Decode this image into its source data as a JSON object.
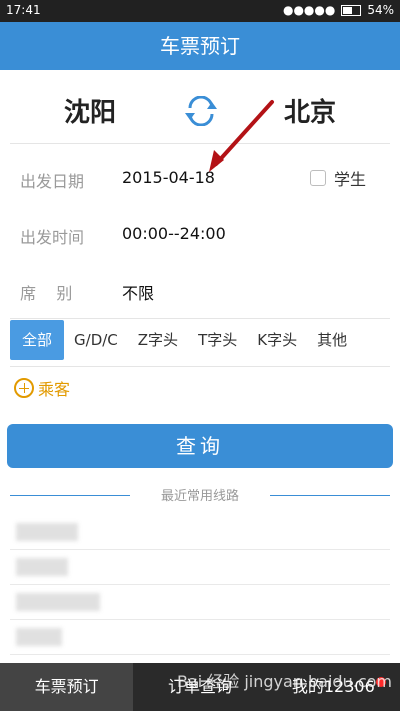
{
  "statusbar": {
    "time": "17:41",
    "signal": "●●●●●",
    "battery": "54%"
  },
  "header": {
    "title": "车票预订"
  },
  "cities": {
    "from": "沈阳",
    "to": "北京"
  },
  "form": {
    "date_label": "出发日期",
    "date_value": "2015-04-18",
    "student_label": "学生",
    "time_label": "出发时间",
    "time_value": "00:00--24:00",
    "seat_label": "席    别",
    "seat_value": "不限"
  },
  "filters": [
    "全部",
    "G/D/C",
    "Z字头",
    "T字头",
    "K字头",
    "其他"
  ],
  "passenger": {
    "label": "乘客"
  },
  "query_button": "查询",
  "recent": {
    "title": "最近常用线路"
  },
  "tabs": [
    "车票预订",
    "订单查询",
    "我的12306"
  ],
  "watermark": "Bai 经验 jingyan.baidu.com",
  "colors": {
    "primary": "#3a8ed6",
    "accent": "#e29a00",
    "dark": "#2a2a2a"
  }
}
